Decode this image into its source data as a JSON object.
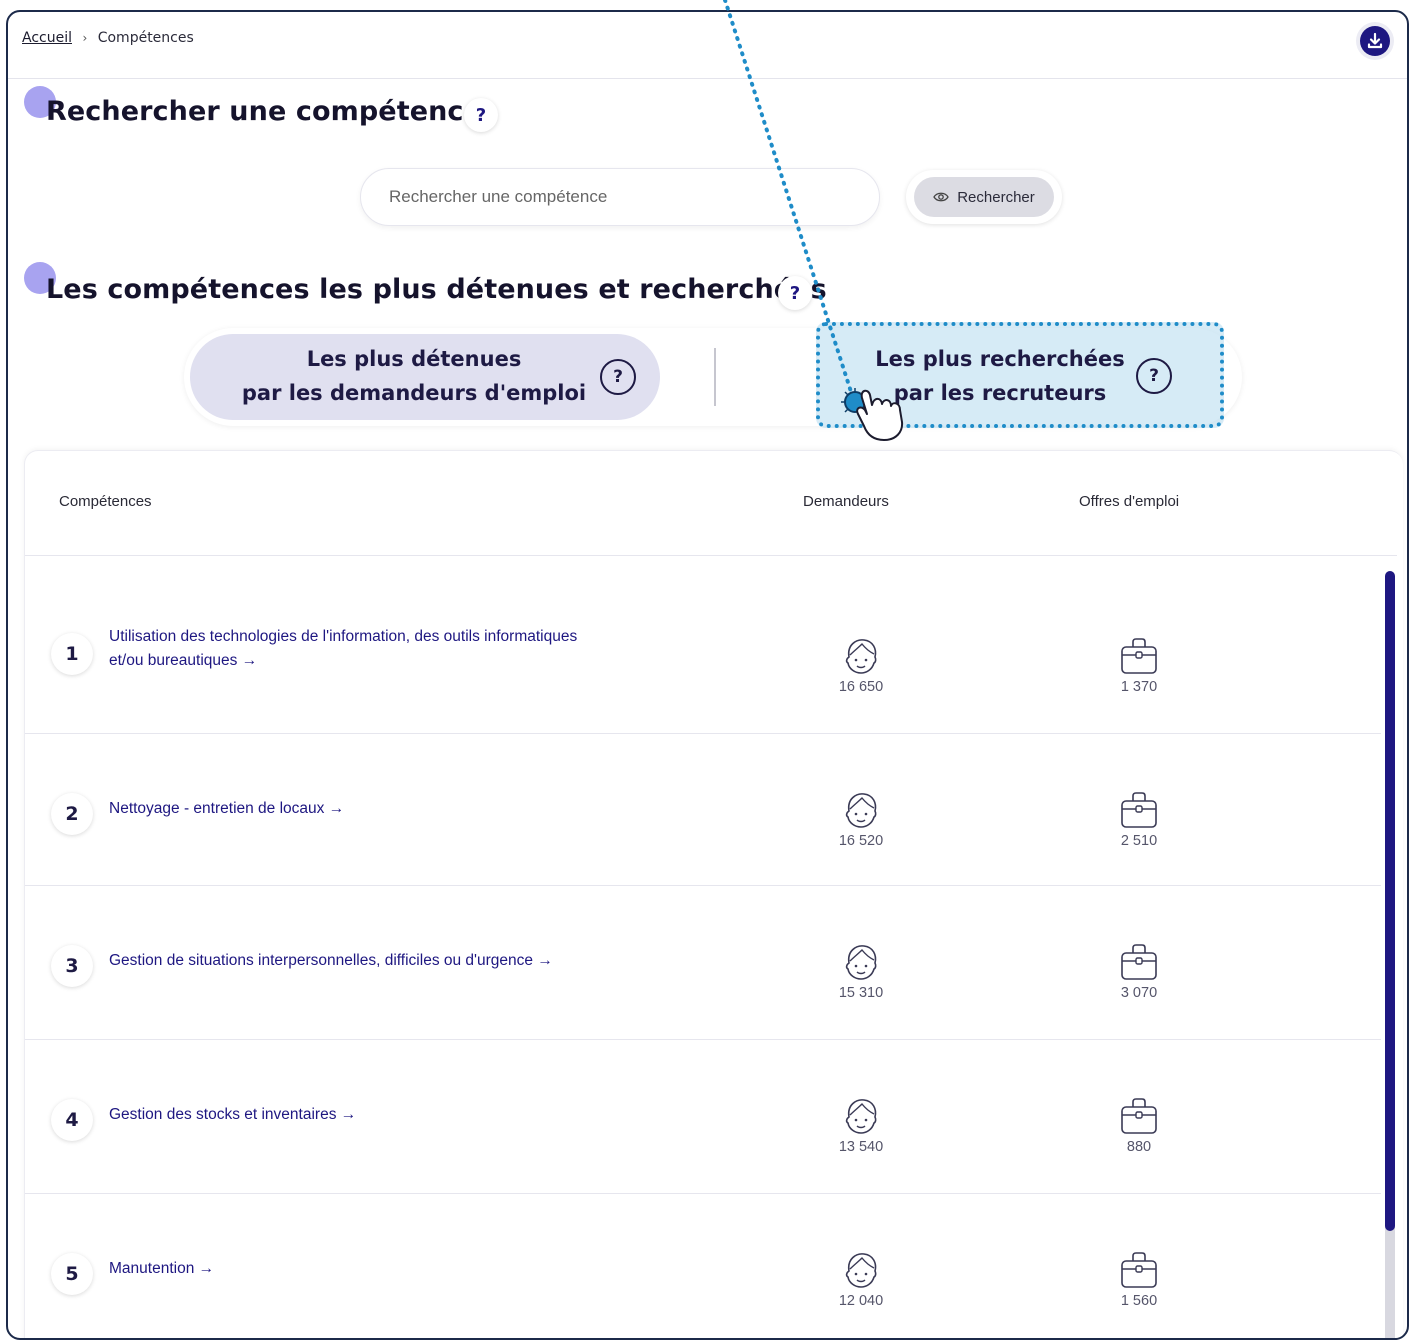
{
  "breadcrumb": {
    "home": "Accueil",
    "current": "Compétences"
  },
  "search_section": {
    "title": "Rechercher une compétence",
    "help": "?",
    "placeholder": "Rechercher une compétence",
    "button_label": "Rechercher"
  },
  "top_section": {
    "title": "Les compétences les plus détenues et recherchées",
    "help": "?",
    "tab_held": {
      "line1": "Les plus détenues",
      "line2": "par les demandeurs d'emploi"
    },
    "tab_sought": {
      "line1": "Les plus recherchées",
      "line2": "par les recruteurs"
    },
    "tab_help": "?"
  },
  "table": {
    "headers": {
      "skills": "Compétences",
      "seekers": "Demandeurs",
      "offers": "Offres d'emploi"
    },
    "rows": [
      {
        "rank": "1",
        "label": "Utilisation des technologies de l'information, des outils informatiques et/ou bureautiques →",
        "seekers": "16 650",
        "offers": "1 370"
      },
      {
        "rank": "2",
        "label": "Nettoyage - entretien de locaux →",
        "seekers": "16 520",
        "offers": "2 510"
      },
      {
        "rank": "3",
        "label": "Gestion de situations interpersonnelles, difficiles ou d'urgence →",
        "seekers": "15 310",
        "offers": "3 070"
      },
      {
        "rank": "4",
        "label": "Gestion des stocks et inventaires →",
        "seekers": "13 540",
        "offers": "880"
      },
      {
        "rank": "5",
        "label": "Manutention →",
        "seekers": "12 040",
        "offers": "1 560"
      }
    ]
  },
  "icons": {
    "download": "download-icon",
    "eye": "eye-icon",
    "seeker": "face-icon",
    "offer": "briefcase-icon",
    "pointer": "hand-pointer-icon"
  },
  "colors": {
    "accent": "#1e1781",
    "highlight_border": "#1f8cc8",
    "highlight_fill": "#d3e8f3",
    "title_dot": "#a8a3f0",
    "active_tab": "#e0e0f0"
  }
}
